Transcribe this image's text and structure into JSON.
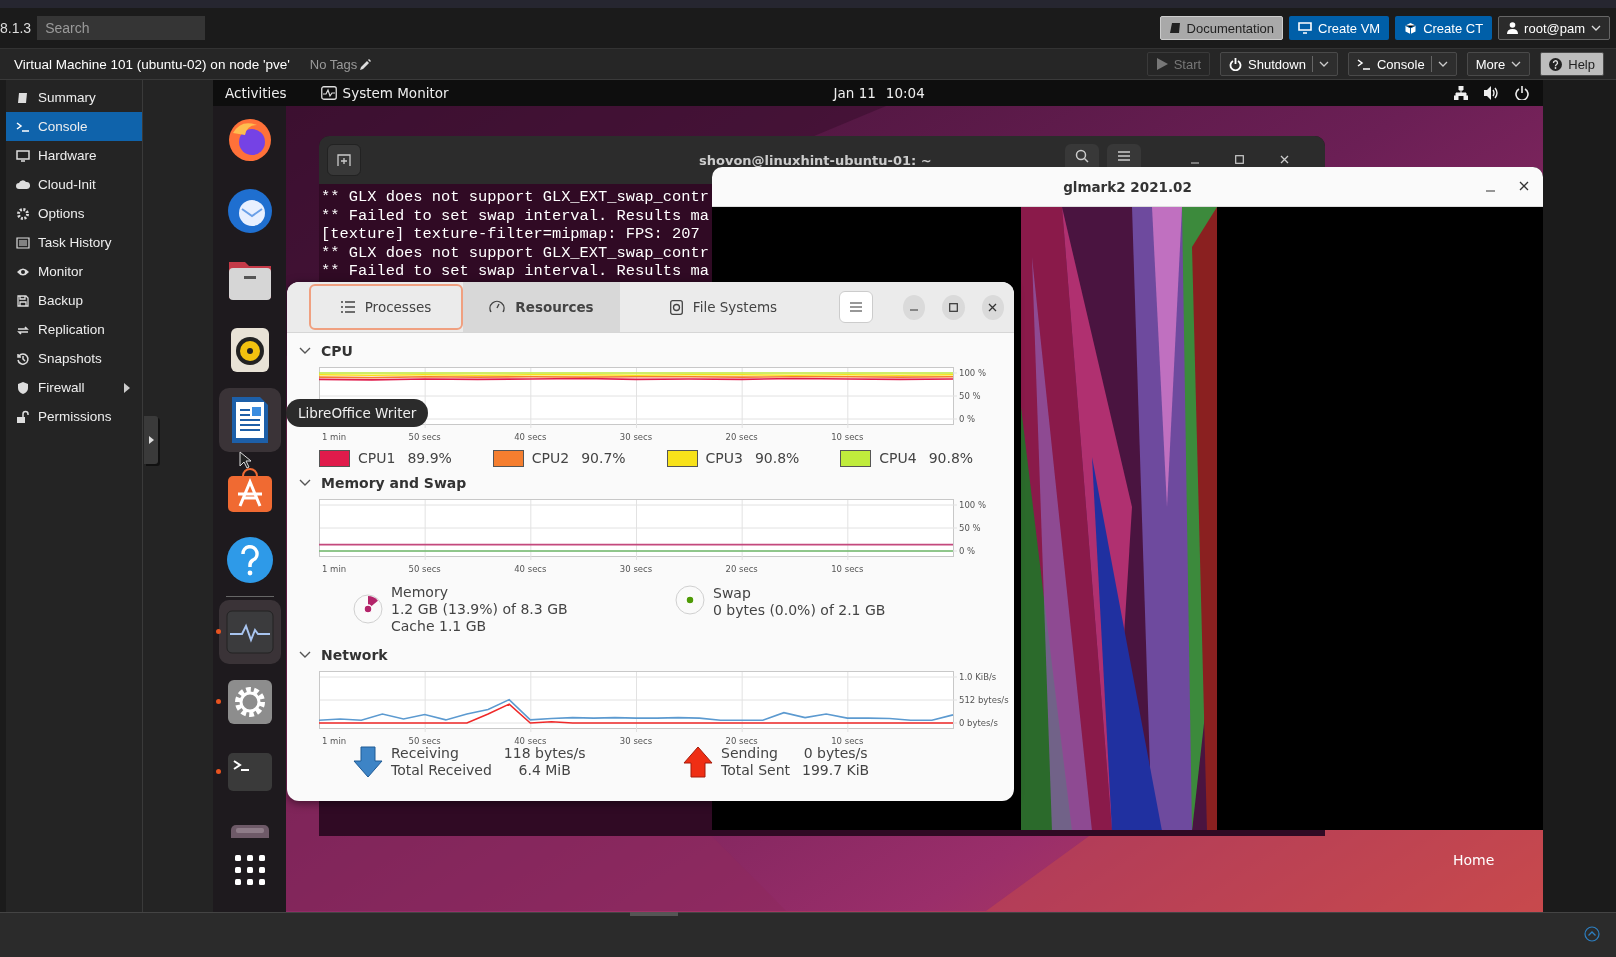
{
  "proxmox": {
    "version": "8.1.3",
    "search": {
      "placeholder": "Search"
    },
    "header_buttons": [
      {
        "label": "Documentation",
        "kind": "doc"
      },
      {
        "label": "Create VM",
        "kind": "vm"
      },
      {
        "label": "Create CT",
        "kind": "ct"
      },
      {
        "label": "root@pam",
        "kind": "user"
      }
    ],
    "vm_title": "Virtual Machine 101 (ubuntu-02) on node 'pve'",
    "tags": "No Tags",
    "toolbar": [
      {
        "label": "Start",
        "kind": "start",
        "disabled": true,
        "dropdown": false,
        "split": false
      },
      {
        "label": "Shutdown",
        "kind": "power",
        "disabled": false,
        "dropdown": true,
        "split": true
      },
      {
        "label": "Console",
        "kind": "console",
        "disabled": false,
        "dropdown": true,
        "split": true
      },
      {
        "label": "More",
        "kind": "more",
        "disabled": false,
        "dropdown": true,
        "split": false
      },
      {
        "label": "Help",
        "kind": "help",
        "disabled": false,
        "dropdown": false,
        "split": false
      }
    ],
    "nav": [
      {
        "label": "Summary",
        "selected": false,
        "submenu": false
      },
      {
        "label": "Console",
        "selected": true,
        "submenu": false
      },
      {
        "label": "Hardware",
        "selected": false,
        "submenu": false
      },
      {
        "label": "Cloud-Init",
        "selected": false,
        "submenu": false
      },
      {
        "label": "Options",
        "selected": false,
        "submenu": false
      },
      {
        "label": "Task History",
        "selected": false,
        "submenu": false
      },
      {
        "label": "Monitor",
        "selected": false,
        "submenu": false
      },
      {
        "label": "Backup",
        "selected": false,
        "submenu": false
      },
      {
        "label": "Replication",
        "selected": false,
        "submenu": false
      },
      {
        "label": "Snapshots",
        "selected": false,
        "submenu": false
      },
      {
        "label": "Firewall",
        "selected": false,
        "submenu": true
      },
      {
        "label": "Permissions",
        "selected": false,
        "submenu": false
      }
    ]
  },
  "vm": {
    "topbar": {
      "activities": "Activities",
      "app": "System Monitor",
      "date": "Jan 11",
      "time": "10:04"
    },
    "dock": [
      {
        "running": false,
        "highlighted": false
      },
      {
        "running": false,
        "highlighted": false
      },
      {
        "running": false,
        "highlighted": false
      },
      {
        "running": false,
        "highlighted": false
      },
      {
        "running": false,
        "highlighted": true
      },
      {
        "running": false,
        "highlighted": false
      },
      {
        "running": false,
        "highlighted": false
      },
      {
        "running": true,
        "highlighted": true
      },
      {
        "running": true,
        "highlighted": false
      },
      {
        "running": true,
        "highlighted": false
      },
      {
        "running": false,
        "highlighted": false
      }
    ],
    "tooltip": "LibreOffice Writer",
    "desktop_label": "Home",
    "terminal": {
      "title": "shovon@linuxhint-ubuntu-01: ~",
      "lines": [
        "** GLX does not support GLX_EXT_swap_contr",
        "** Failed to set swap interval. Results ma",
        "[texture] texture-filter=mipmap: FPS: 207",
        "** GLX does not support GLX_EXT_swap_contr",
        "** Failed to set swap interval. Results ma"
      ]
    },
    "glmark": {
      "title": "glmark2 2021.02"
    },
    "monitor": {
      "tabs": [
        {
          "label": "Processes",
          "selected": false,
          "focused": true
        },
        {
          "label": "Resources",
          "selected": true,
          "focused": false
        },
        {
          "label": "File Systems",
          "selected": false,
          "focused": false
        }
      ],
      "cpu": {
        "title": "CPU",
        "expanded": true,
        "chart_data": {
          "type": "line",
          "grid": true,
          "x": [
            60,
            55,
            50,
            45,
            40,
            35,
            30,
            25,
            20,
            15,
            10,
            5,
            0
          ],
          "xlim": [
            60,
            0
          ],
          "ylim": [
            0,
            100
          ],
          "xticks": [
            {
              "value": 50,
              "label": "50 secs"
            },
            {
              "value": 40,
              "label": "40 secs"
            },
            {
              "value": 30,
              "label": "30 secs"
            },
            {
              "value": 20,
              "label": "20 secs"
            },
            {
              "value": 10,
              "label": "10 secs"
            }
          ],
          "yticks": [
            {
              "value": 0,
              "label": "0 %"
            },
            {
              "value": 50,
              "label": "50 %"
            },
            {
              "value": 100,
              "label": "100 %"
            }
          ],
          "series": [
            {
              "name": "CPU1",
              "color": "#e01b4b",
              "values": [
                86,
                85,
                87,
                86,
                87,
                88,
                86,
                87,
                86,
                88,
                87,
                86,
                87
              ]
            },
            {
              "name": "CPU2",
              "color": "#f57e2f",
              "values": [
                91,
                90,
                92,
                91,
                92,
                91,
                92,
                92,
                91,
                92,
                92,
                91,
                92
              ]
            },
            {
              "name": "CPU3",
              "color": "#f8e21a",
              "values": [
                96,
                95,
                96,
                95,
                96,
                96,
                95,
                96,
                96,
                95,
                96,
                95,
                96
              ]
            },
            {
              "name": "CPU4",
              "color": "#c0ec3c",
              "values": [
                100,
                100,
                100,
                100,
                100,
                100,
                100,
                100,
                100,
                100,
                100,
                100,
                100
              ]
            }
          ]
        },
        "edge_labels": {
          "x_start": "1 min"
        },
        "readings": [
          "89.9%",
          "90.7%",
          "90.8%",
          "90.8%"
        ]
      },
      "memory": {
        "title": "Memory and Swap",
        "expanded": true,
        "chart_data": {
          "type": "line",
          "grid": true,
          "x": [
            60,
            0
          ],
          "xlim": [
            60,
            0
          ],
          "ylim": [
            0,
            100
          ],
          "xticks": [
            {
              "value": 50,
              "label": "50 secs"
            },
            {
              "value": 40,
              "label": "40 secs"
            },
            {
              "value": 30,
              "label": "30 secs"
            },
            {
              "value": 20,
              "label": "20 secs"
            },
            {
              "value": 10,
              "label": "10 secs"
            }
          ],
          "yticks": [
            {
              "value": 0,
              "label": "0 %"
            },
            {
              "value": 50,
              "label": "50 %"
            },
            {
              "value": 100,
              "label": "100 %"
            }
          ],
          "series": [
            {
              "name": "Memory",
              "color": "#c4497d",
              "values": [
                14,
                14
              ]
            },
            {
              "name": "Swap",
              "color": "#6fb86a",
              "values": [
                0,
                0
              ]
            }
          ]
        },
        "edge_labels": {
          "x_start": "1 min"
        },
        "items": [
          {
            "lines": [
              "1.2 GB (13.9%) of 8.3 GB",
              "Cache 1.1 GB"
            ],
            "level": 0.139
          },
          {
            "lines": [
              "0 bytes (0.0%) of 2.1 GB"
            ]
          }
        ]
      },
      "network": {
        "title": "Network",
        "expanded": true,
        "chart_data": {
          "type": "line",
          "grid": true,
          "x": [
            60,
            58,
            56,
            54,
            52,
            50,
            48,
            46,
            44,
            42,
            40,
            38,
            36,
            34,
            32,
            30,
            28,
            26,
            24,
            22,
            20,
            18,
            16,
            14,
            12,
            10,
            8,
            6,
            4,
            2,
            0
          ],
          "xlim": [
            60,
            0
          ],
          "ylim": [
            0,
            1024
          ],
          "xticks": [
            {
              "value": 50,
              "label": "50 secs"
            },
            {
              "value": 40,
              "label": "40 secs"
            },
            {
              "value": 30,
              "label": "30 secs"
            },
            {
              "value": 20,
              "label": "20 secs"
            },
            {
              "value": 10,
              "label": "10 secs"
            }
          ],
          "yticks": [
            {
              "value": 0,
              "label": "0 bytes/s"
            },
            {
              "value": 512,
              "label": "512 bytes/s"
            }
          ],
          "series": [
            {
              "name": "Receiving",
              "color": "#5c9ad0",
              "values": [
                60,
                90,
                60,
                200,
                90,
                190,
                70,
                200,
                300,
                520,
                70,
                100,
                120,
                110,
                120,
                110,
                110,
                120,
                110,
                60,
                60,
                60,
                230,
                120,
                200,
                110,
                110,
                100,
                60,
                60,
                180
              ]
            },
            {
              "name": "Sending",
              "color": "#ef2929",
              "values": [
                0,
                0,
                0,
                0,
                0,
                0,
                0,
                0,
                200,
                420,
                0,
                30,
                0,
                0,
                0,
                0,
                0,
                0,
                0,
                0,
                0,
                0,
                0,
                0,
                0,
                0,
                0,
                0,
                0,
                0,
                0
              ]
            }
          ]
        },
        "edge_labels": {
          "x_start": "1 min",
          "y_top": "1.0 KiB/s"
        },
        "items": [
          {
            "kind": "receive",
            "value": "118 bytes/s",
            "total_label": "Total Received",
            "total": "6.4 MiB"
          },
          {
            "kind": "send",
            "value": "0 bytes/s",
            "total_label": "Total Sent",
            "total": "199.7 KiB"
          }
        ]
      }
    }
  }
}
